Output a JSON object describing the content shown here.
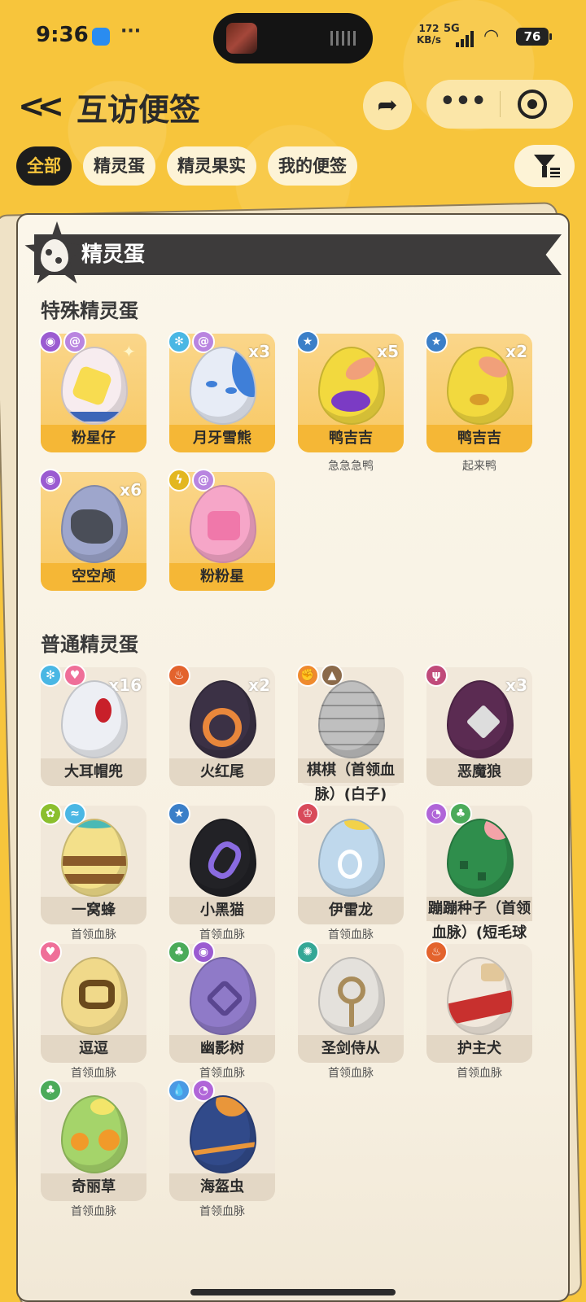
{
  "status": {
    "time": "9:36",
    "more": "···",
    "net_speed_value": "172",
    "net_speed_unit": "KB/s",
    "net_type": "5G",
    "battery": "76"
  },
  "header": {
    "back_icon": "chevrons-left-icon",
    "title": "互访便签",
    "share_icon": "share-arrow-icon",
    "capsule_more": "•••",
    "capsule_close_icon": "target-close-icon"
  },
  "tabs": [
    {
      "label": "全部",
      "active": true
    },
    {
      "label": "精灵蛋",
      "active": false
    },
    {
      "label": "精灵果实",
      "active": false
    },
    {
      "label": "我的便签",
      "active": false
    }
  ],
  "filter_icon": "filter-funnel-icon",
  "section": {
    "title": "精灵蛋",
    "special_title": "特殊精灵蛋",
    "normal_title": "普通精灵蛋"
  },
  "special_eggs": [
    {
      "name": "粉星仔",
      "count": "",
      "sub": ""
    },
    {
      "name": "月牙雪熊",
      "count": "x3",
      "sub": ""
    },
    {
      "name": "鸭吉吉",
      "count": "x5",
      "sub": "急急急鸭"
    },
    {
      "name": "鸭吉吉",
      "count": "x2",
      "sub": "起来鸭"
    },
    {
      "name": "空空颅",
      "count": "x6",
      "sub": ""
    },
    {
      "name": "粉粉星",
      "count": "",
      "sub": ""
    }
  ],
  "normal_eggs": [
    {
      "name": "大耳帽兜",
      "count": "x16",
      "sub": ""
    },
    {
      "name": "火红尾",
      "count": "x2",
      "sub": ""
    },
    {
      "name_line1": "棋棋（首领血",
      "name_line2": "脉）(白子)",
      "count": "",
      "sub": ""
    },
    {
      "name": "恶魔狼",
      "count": "x3",
      "sub": ""
    },
    {
      "name": "一窝蜂",
      "count": "",
      "sub": "首领血脉"
    },
    {
      "name": "小黑猫",
      "count": "",
      "sub": "首领血脉"
    },
    {
      "name": "伊雷龙",
      "count": "",
      "sub": "首领血脉"
    },
    {
      "name_line1": "蹦蹦种子（首领",
      "name_line2": "血脉）(短毛球",
      "count": "",
      "sub": ""
    },
    {
      "name": "逗逗",
      "count": "",
      "sub": "首领血脉"
    },
    {
      "name": "幽影树",
      "count": "",
      "sub": "首领血脉"
    },
    {
      "name": "圣剑侍从",
      "count": "",
      "sub": "首领血脉"
    },
    {
      "name": "护主犬",
      "count": "",
      "sub": "首领血脉"
    },
    {
      "name": "奇丽草",
      "count": "",
      "sub": "首领血脉"
    },
    {
      "name": "海盔虫",
      "count": "",
      "sub": "首领血脉"
    }
  ],
  "colors": {
    "background": "#f7c53c",
    "tab_active_bg": "#1d1d1d",
    "tab_active_text": "#f7c53c",
    "special_card": "#f8c863",
    "normal_card": "#f1e8da"
  }
}
